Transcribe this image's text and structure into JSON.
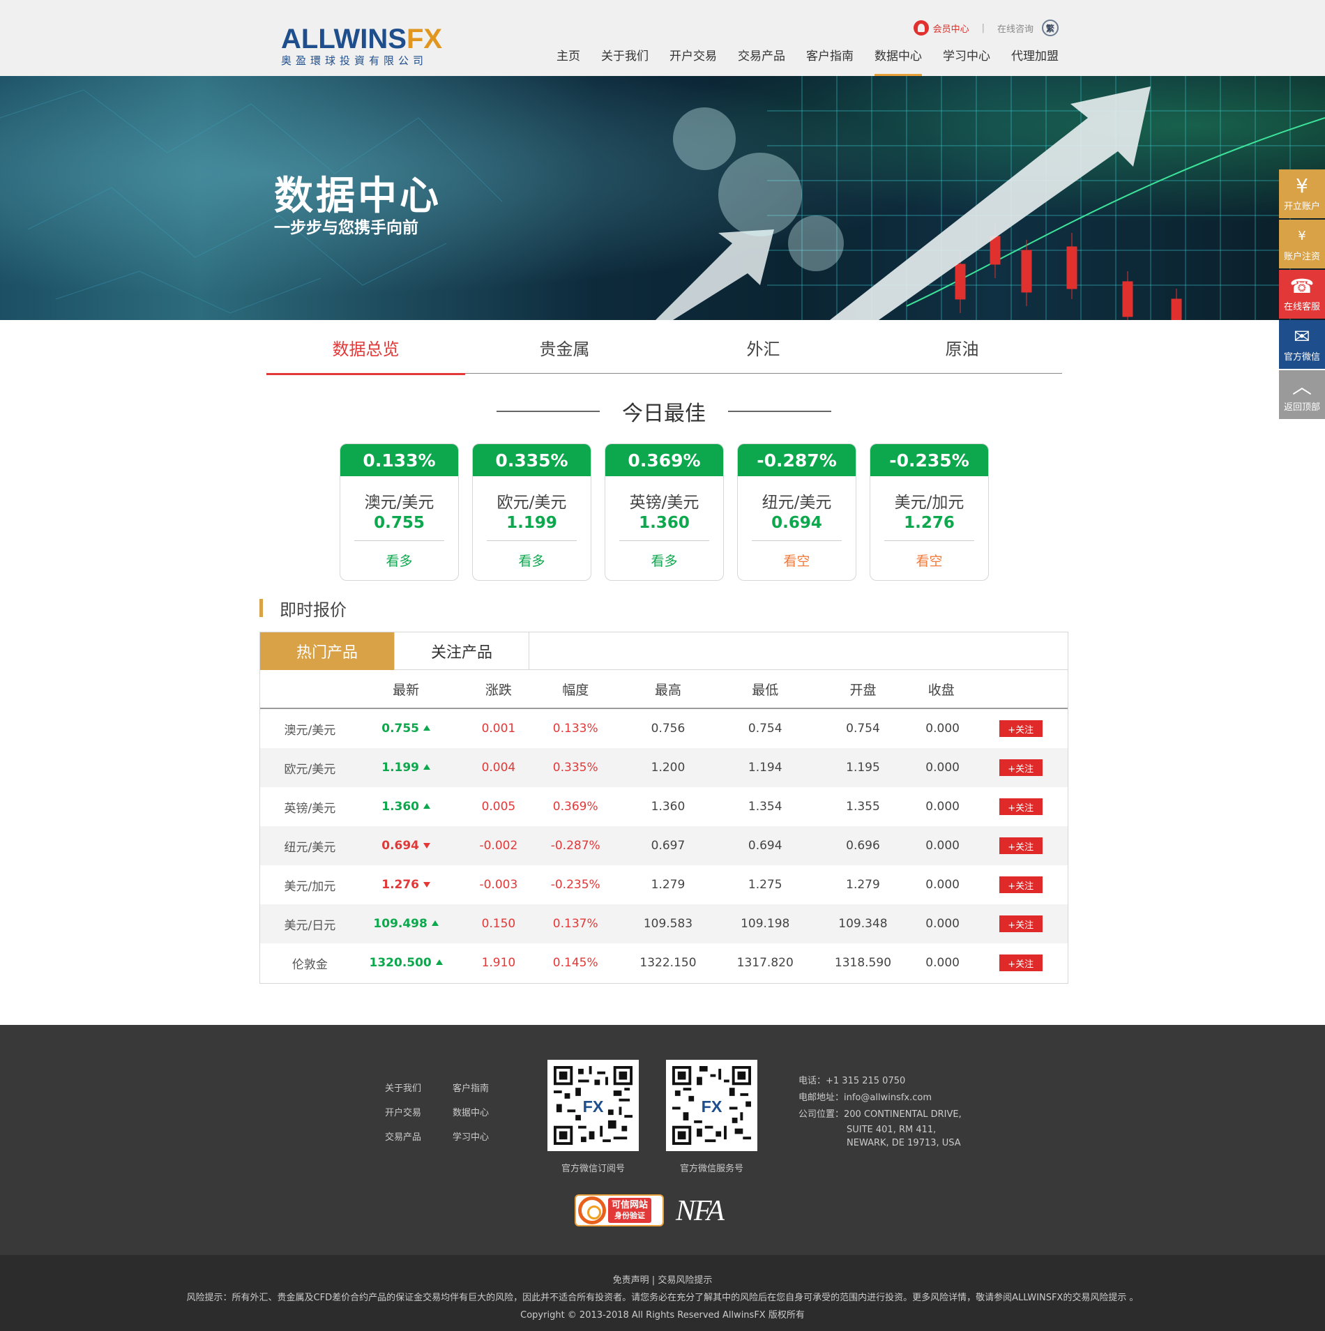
{
  "header": {
    "logo_main": "ALLWINS",
    "logo_fx": "FX",
    "logo_sub": "奥盈環球投資有限公司",
    "member_center": "会员中心",
    "separator": "|",
    "online_consult": "在线咨询",
    "lang_toggle": "繁",
    "nav": [
      "主页",
      "关于我们",
      "开户交易",
      "交易产品",
      "客户指南",
      "数据中心",
      "学习中心",
      "代理加盟"
    ],
    "active_nav": "数据中心"
  },
  "banner": {
    "title": "数据中心",
    "subtitle": "一步步与您携手向前"
  },
  "float_bar": [
    {
      "icon": "yen-icon",
      "glyph": "¥",
      "label": "开立账户"
    },
    {
      "icon": "wallet-icon",
      "glyph": "¥",
      "label": "账户注资"
    },
    {
      "icon": "headset-icon",
      "glyph": "☎",
      "label": "在线客服"
    },
    {
      "icon": "wechat-icon",
      "glyph": "✉",
      "label": "官方微信"
    },
    {
      "icon": "arrow-up-icon",
      "glyph": "︿",
      "label": "返回顶部"
    }
  ],
  "tabs": [
    "数据总览",
    "贵金属",
    "外汇",
    "原油"
  ],
  "best": {
    "title": "今日最佳",
    "cards": [
      {
        "change": "0.133%",
        "name": "澳元/美元",
        "price": "0.755",
        "trend": "看多",
        "dir": "up"
      },
      {
        "change": "0.335%",
        "name": "欧元/美元",
        "price": "1.199",
        "trend": "看多",
        "dir": "up"
      },
      {
        "change": "0.369%",
        "name": "英镑/美元",
        "price": "1.360",
        "trend": "看多",
        "dir": "up"
      },
      {
        "change": "-0.287%",
        "name": "纽元/美元",
        "price": "0.694",
        "trend": "看空",
        "dir": "down"
      },
      {
        "change": "-0.235%",
        "name": "美元/加元",
        "price": "1.276",
        "trend": "看空",
        "dir": "down"
      }
    ]
  },
  "quotes": {
    "title": "即时报价",
    "tabs": [
      "热门产品",
      "关注产品"
    ],
    "columns": [
      "",
      "最新",
      "涨跌",
      "幅度",
      "最高",
      "最低",
      "开盘",
      "收盘",
      ""
    ],
    "follow_label": "+关注",
    "rows": [
      {
        "name": "澳元/美元",
        "latest": "0.755",
        "dir": "up",
        "change": "0.001",
        "pct": "0.133%",
        "high": "0.756",
        "low": "0.754",
        "open": "0.754",
        "close": "0.000"
      },
      {
        "name": "欧元/美元",
        "latest": "1.199",
        "dir": "up",
        "change": "0.004",
        "pct": "0.335%",
        "high": "1.200",
        "low": "1.194",
        "open": "1.195",
        "close": "0.000"
      },
      {
        "name": "英镑/美元",
        "latest": "1.360",
        "dir": "up",
        "change": "0.005",
        "pct": "0.369%",
        "high": "1.360",
        "low": "1.354",
        "open": "1.355",
        "close": "0.000"
      },
      {
        "name": "纽元/美元",
        "latest": "0.694",
        "dir": "down",
        "change": "-0.002",
        "pct": "-0.287%",
        "high": "0.697",
        "low": "0.694",
        "open": "0.696",
        "close": "0.000"
      },
      {
        "name": "美元/加元",
        "latest": "1.276",
        "dir": "down",
        "change": "-0.003",
        "pct": "-0.235%",
        "high": "1.279",
        "low": "1.275",
        "open": "1.279",
        "close": "0.000"
      },
      {
        "name": "美元/日元",
        "latest": "109.498",
        "dir": "up",
        "change": "0.150",
        "pct": "0.137%",
        "high": "109.583",
        "low": "109.198",
        "open": "109.348",
        "close": "0.000"
      },
      {
        "name": "伦敦金",
        "latest": "1320.500",
        "dir": "up",
        "change": "1.910",
        "pct": "0.145%",
        "high": "1322.150",
        "low": "1317.820",
        "open": "1318.590",
        "close": "0.000"
      }
    ]
  },
  "footer": {
    "links": [
      "关于我们",
      "客户指南",
      "开户交易",
      "数据中心",
      "交易产品",
      "学习中心"
    ],
    "qr1_label": "官方微信订阅号",
    "qr2_label": "官方微信服务号",
    "phone": "电话：+1 315 215 0750",
    "email": "电邮地址：info@allwinsfx.com",
    "address_1": "公司位置：200 CONTINENTAL DRIVE,",
    "address_2": "SUITE 401, RM 411,",
    "address_3": "NEWARK, DE 19713, USA",
    "trust_badge_line1": "可信网站",
    "trust_badge_line2": "身份验证",
    "nfa": "NFA"
  },
  "bottom": {
    "links": "免责声明  |  交易风险提示",
    "risk": "风险提示：所有外汇、贵金属及CFD差价合约产品的保证金交易均伴有巨大的风险，因此并不适合所有投资者。请您务必在充分了解其中的风险后在您自身可承受的范围内进行投资。更多风险详情，敬请参阅ALLWINSFX的交易风险提示 。",
    "copyright": "Copyright © 2013-2018 All Rights Reserved AllwinsFX 版权所有"
  },
  "colors": {
    "brand_blue": "#1f4e8c",
    "brand_gold": "#d9a247",
    "up_green": "#0da84d",
    "down_red": "#e23837"
  }
}
